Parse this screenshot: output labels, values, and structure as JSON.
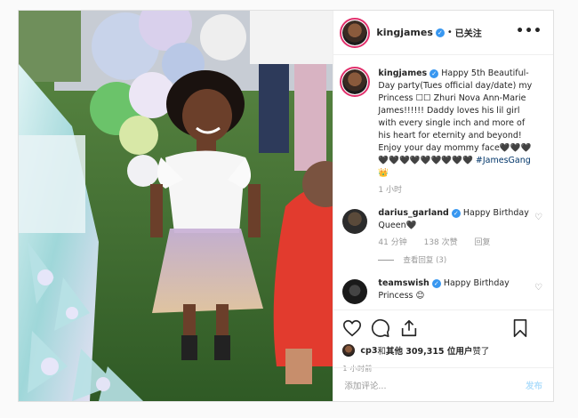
{
  "post": {
    "username": "kingjames",
    "separator": "•",
    "follow_status": "已关注",
    "more_label": "•••"
  },
  "caption": {
    "username": "kingjames",
    "text": "Happy 5th Beautiful-Day party(Tues official day/date) my Princess ☐☐ Zhuri Nova Ann-Marie James!!!!!! Daddy loves his lil girl with every single inch and more of his heart for eternity and beyond! Enjoy your day mommy face🖤🖤🖤🖤🖤🖤🖤🖤🖤🖤🖤🖤",
    "hashtag": "#JamesGang👑",
    "time": "1 小时"
  },
  "comments": [
    {
      "username": "darius_garland",
      "text": "Happy Birthday Queen🖤",
      "time": "41 分钟",
      "likes": "138 次赞",
      "reply": "回复",
      "view_replies": "查看回复 (3)"
    },
    {
      "username": "teamswish",
      "text": "Happy Birthday Princess 😊"
    }
  ],
  "likes": {
    "prefix_user": "cp3",
    "text_mid": " 和 ",
    "others": "其他 309,315 位用户",
    "suffix": " 赞了"
  },
  "time_ago": "1 小时前",
  "add_comment": {
    "placeholder": "添加评论...",
    "post_label": "发布"
  }
}
